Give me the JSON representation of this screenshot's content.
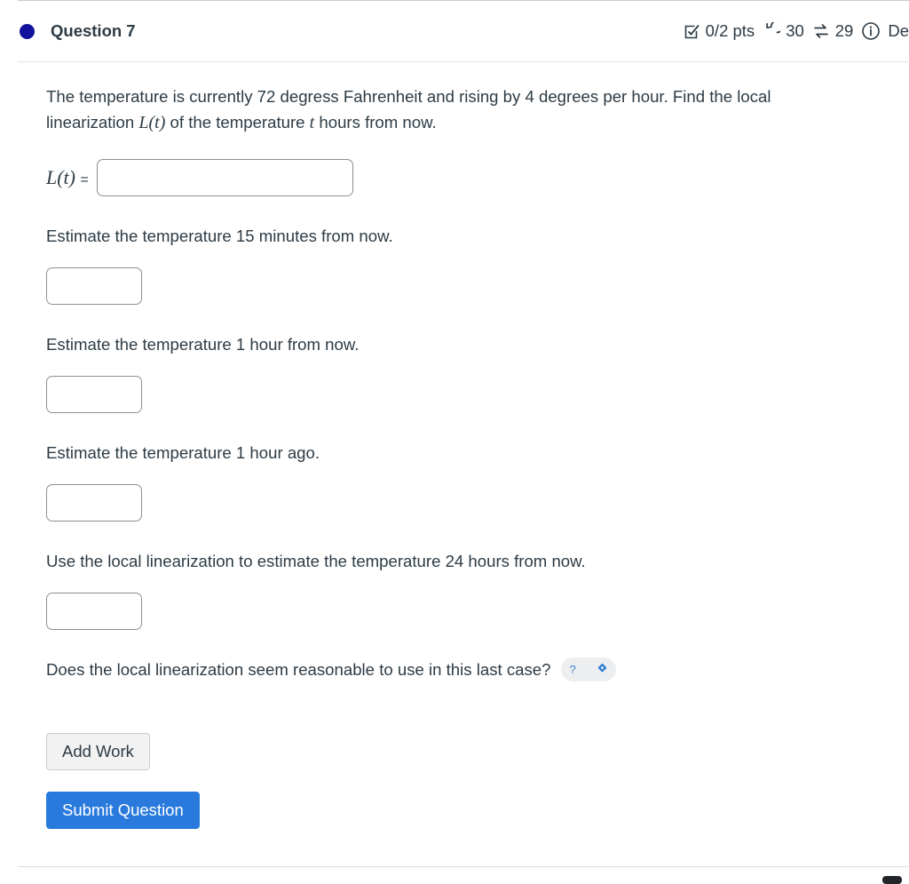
{
  "header": {
    "status_dot_color": "#12129c",
    "title": "Question 7",
    "points_icon": "checkbox-icon",
    "points": "0/2 pts",
    "attempts_icon": "undo-arrow-icon",
    "attempts": "30",
    "exchange_icon": "swap-arrows-icon",
    "exchanges": "29",
    "info_icon": "info-circle-icon",
    "details_label": "De"
  },
  "body": {
    "intro_part1": "The temperature is currently 72 degress Fahrenheit and rising by 4 degrees per hour. Find the local linearization ",
    "intro_math1": "L(t)",
    "intro_part2": " of the temperature ",
    "intro_math2": "t",
    "intro_part3": " hours from now.",
    "lt_label": "L(t)",
    "lt_equals": "=",
    "lt_value": "",
    "lt_placeholder": "",
    "prompt_15min": "Estimate the temperature 15 minutes from now.",
    "answer_15min": "",
    "prompt_1hour_from": "Estimate the temperature 1 hour from now.",
    "answer_1hour_from": "",
    "prompt_1hour_ago": "Estimate the temperature 1 hour ago.",
    "answer_1hour_ago": "",
    "prompt_24hours": "Use the local linearization to estimate the temperature 24 hours from now.",
    "answer_24hours": "",
    "prompt_reasonable": "Does the local linearization seem reasonable to use in this last case?",
    "reasonable_selected": "?"
  },
  "actions": {
    "add_work_label": "Add Work",
    "submit_label": "Submit Question",
    "submit_color": "#2a7ade"
  }
}
